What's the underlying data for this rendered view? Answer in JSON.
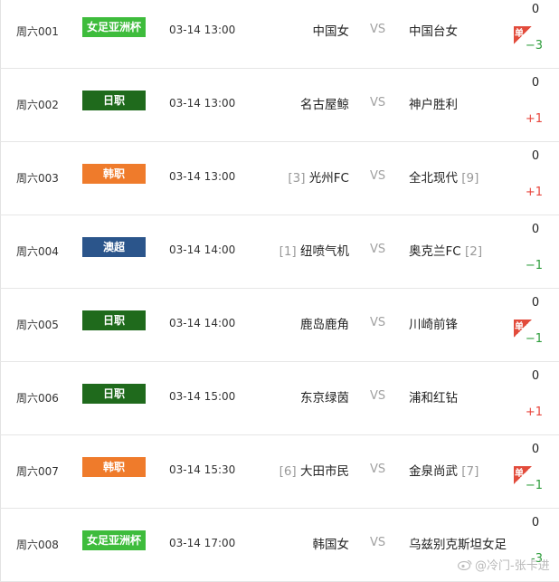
{
  "matches": [
    {
      "code": "周六001",
      "league": "女足亚洲杯",
      "league_color": "#3ebc3c",
      "time": "03-14 13:00",
      "home_rank": "",
      "home": "中国女",
      "vs": "VS",
      "away": "中国台女",
      "away_rank": "",
      "score": "0",
      "handicap": "−3",
      "handicap_sign": "neg",
      "dan": true
    },
    {
      "code": "周六002",
      "league": "日职",
      "league_color": "#1f6a1c",
      "time": "03-14 13:00",
      "home_rank": "",
      "home": "名古屋鲸",
      "vs": "VS",
      "away": "神户胜利",
      "away_rank": "",
      "score": "0",
      "handicap": "+1",
      "handicap_sign": "pos",
      "dan": false
    },
    {
      "code": "周六003",
      "league": "韩职",
      "league_color": "#ef7b2b",
      "time": "03-14 13:00",
      "home_rank": "[3]",
      "home": "光州FC",
      "vs": "VS",
      "away": "全北现代",
      "away_rank": "[9]",
      "score": "0",
      "handicap": "+1",
      "handicap_sign": "pos",
      "dan": false
    },
    {
      "code": "周六004",
      "league": "澳超",
      "league_color": "#2b558b",
      "time": "03-14 14:00",
      "home_rank": "[1]",
      "home": "纽喷气机",
      "vs": "VS",
      "away": "奥克兰FC",
      "away_rank": "[2]",
      "score": "0",
      "handicap": "−1",
      "handicap_sign": "neg",
      "dan": false
    },
    {
      "code": "周六005",
      "league": "日职",
      "league_color": "#1f6a1c",
      "time": "03-14 14:00",
      "home_rank": "",
      "home": "鹿岛鹿角",
      "vs": "VS",
      "away": "川崎前锋",
      "away_rank": "",
      "score": "0",
      "handicap": "−1",
      "handicap_sign": "neg",
      "dan": true
    },
    {
      "code": "周六006",
      "league": "日职",
      "league_color": "#1f6a1c",
      "time": "03-14 15:00",
      "home_rank": "",
      "home": "东京绿茵",
      "vs": "VS",
      "away": "浦和红钻",
      "away_rank": "",
      "score": "0",
      "handicap": "+1",
      "handicap_sign": "pos",
      "dan": false
    },
    {
      "code": "周六007",
      "league": "韩职",
      "league_color": "#ef7b2b",
      "time": "03-14 15:30",
      "home_rank": "[6]",
      "home": "大田市民",
      "vs": "VS",
      "away": "金泉尚武",
      "away_rank": "[7]",
      "score": "0",
      "handicap": "−1",
      "handicap_sign": "neg",
      "dan": true
    },
    {
      "code": "周六008",
      "league": "女足亚洲杯",
      "league_color": "#3ebc3c",
      "time": "03-14 17:00",
      "home_rank": "",
      "home": "韩国女",
      "vs": "VS",
      "away": "乌兹别克斯坦女足",
      "away_rank": "",
      "score": "0",
      "handicap": "-3",
      "handicap_sign": "neg",
      "dan": false
    }
  ],
  "dan_label": "单",
  "watermark": "@冷门-张卡进"
}
